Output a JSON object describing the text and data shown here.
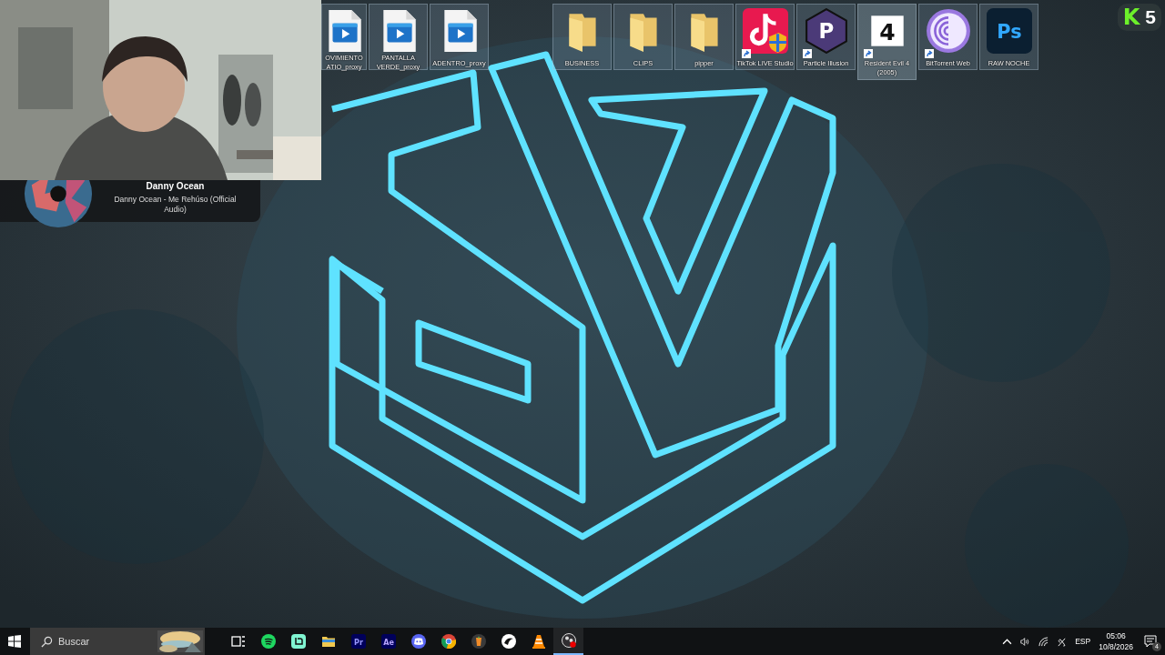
{
  "media_widget": {
    "artist": "Danny Ocean",
    "track": "Danny Ocean - Me Rehúso (Official Audio)"
  },
  "overlay_badge": {
    "logo": "K",
    "count": "5"
  },
  "desktop_icon_groups": [
    {
      "icons": [
        {
          "kind": "video",
          "label": "OVIMIENTO ATIO_proxy",
          "shortcut": false,
          "focused": false,
          "partial": true
        },
        {
          "kind": "video",
          "label": "PANTALLA VERDE_proxy",
          "shortcut": false,
          "focused": false,
          "partial": false
        },
        {
          "kind": "video",
          "label": "ADENTRO_proxy",
          "shortcut": false,
          "focused": false,
          "partial": false
        }
      ]
    },
    {
      "icons": [
        {
          "kind": "folder",
          "label": "BUSINESS",
          "shortcut": false,
          "focused": false,
          "partial": false
        },
        {
          "kind": "folder",
          "label": "CLIPS",
          "shortcut": false,
          "focused": false,
          "partial": false
        },
        {
          "kind": "folder",
          "label": "pipper",
          "shortcut": false,
          "focused": false,
          "partial": false
        },
        {
          "kind": "tiktok",
          "label": "TikTok LIVE Studio",
          "shortcut": true,
          "focused": false,
          "partial": false
        },
        {
          "kind": "particle",
          "label": "Particle Illusion",
          "glyph": "P",
          "shortcut": true,
          "focused": false,
          "partial": false
        },
        {
          "kind": "re4",
          "label": "Resident Evil 4 (2005)",
          "glyph": "4",
          "shortcut": true,
          "focused": true,
          "partial": false
        },
        {
          "kind": "bittorrent",
          "label": "BitTorrent Web",
          "shortcut": true,
          "focused": false,
          "partial": false
        },
        {
          "kind": "photoshop",
          "label": "RAW NOCHE",
          "glyph": "Ps",
          "shortcut": false,
          "focused": false,
          "partial": false
        }
      ]
    }
  ],
  "taskbar": {
    "search": {
      "placeholder": "Buscar"
    },
    "apps": [
      {
        "kind": "taskview",
        "active": false
      },
      {
        "kind": "spotify",
        "active": false
      },
      {
        "kind": "streamlabs",
        "active": false
      },
      {
        "kind": "explorer",
        "active": false
      },
      {
        "kind": "premiere",
        "glyph": "Pr",
        "active": false
      },
      {
        "kind": "aftereffects",
        "glyph": "Ae",
        "active": false
      },
      {
        "kind": "discord",
        "active": false
      },
      {
        "kind": "chrome",
        "active": false
      },
      {
        "kind": "flstudio",
        "active": false
      },
      {
        "kind": "capcut",
        "active": false
      },
      {
        "kind": "vlc",
        "active": false
      },
      {
        "kind": "obs",
        "active": true
      }
    ],
    "tray": {
      "language": "ESP",
      "time": "05:06",
      "date": "10/8/2026",
      "notifications": "4"
    }
  }
}
